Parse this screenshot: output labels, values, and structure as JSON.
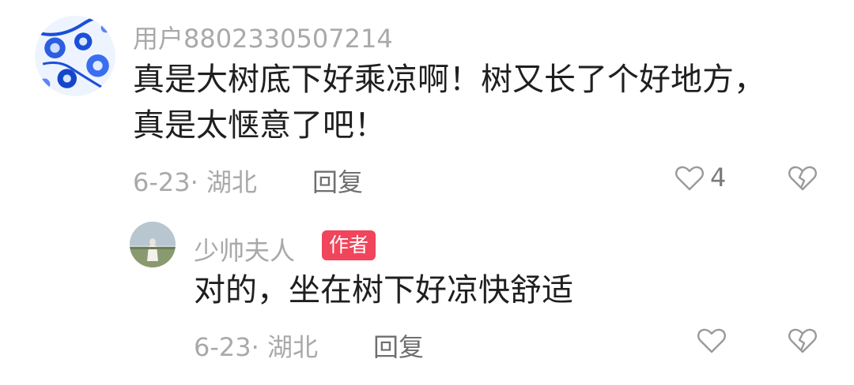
{
  "comment": {
    "username": "用户8802330507214",
    "text_line1": "真是大树底下好乘凉啊！树又长了个好地方，",
    "text_line2": "真是太惬意了吧！",
    "meta": "6-23· 湖北",
    "reply_label": "回复",
    "like_count": "4"
  },
  "reply": {
    "username": "少帅夫人",
    "badge": "作者",
    "text": "对的，坐在树下好凉快舒适",
    "meta": "6-23· 湖北",
    "reply_label": "回复"
  },
  "icons": {
    "like": "heart-outline-icon",
    "dislike": "broken-heart-icon"
  },
  "colors": {
    "username": "#a9a9a9",
    "text": "#1f1f1f",
    "badge": "#f0455b"
  }
}
